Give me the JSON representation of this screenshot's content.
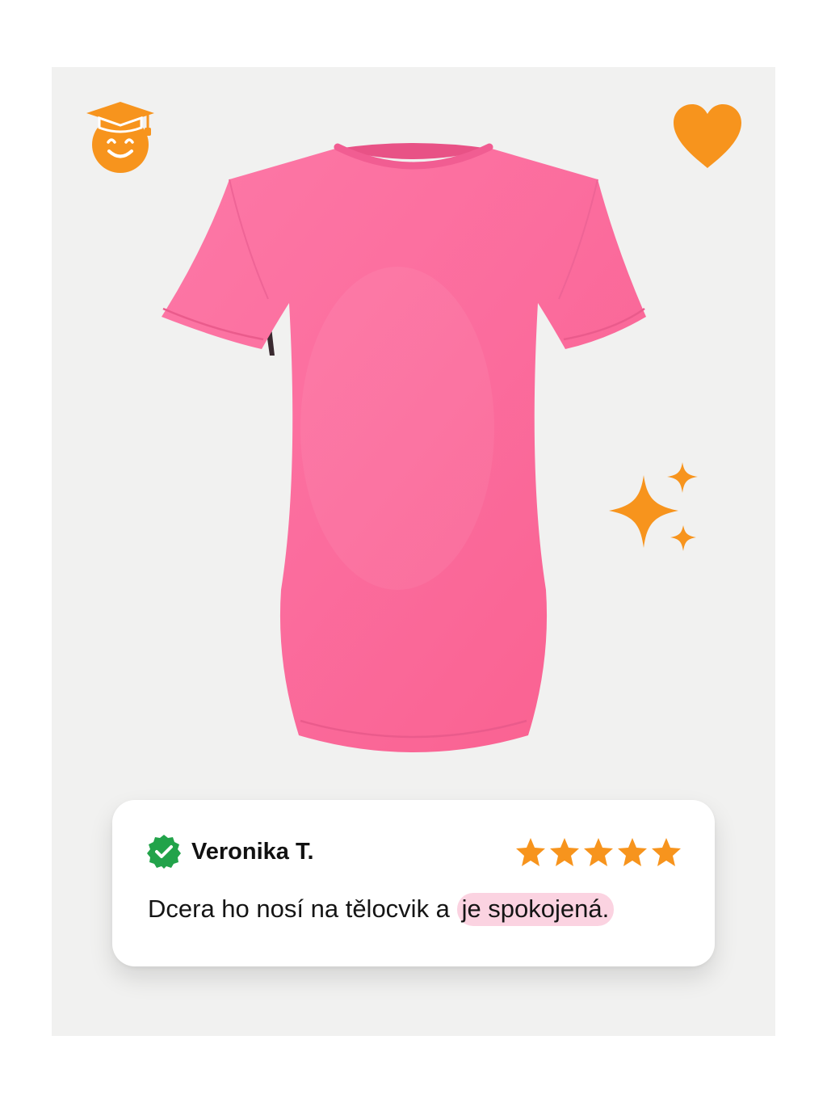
{
  "colors": {
    "accent": "#f7941d",
    "panel_background": "#f1f1f0",
    "shirt": "#fb6c9d",
    "verified": "#22a34a",
    "highlight": "#fbd3e1"
  },
  "icons": {
    "top_left": "graduation-cap-smiley-icon",
    "top_right": "heart-icon",
    "right": "sparkles-icon",
    "verified": "verified-check-badge-icon",
    "rating": "star-icon"
  },
  "review": {
    "name": "Veronika T.",
    "rating": 5,
    "rating_max": 5,
    "text_plain": "Dcera ho nosí na tělocvik a",
    "text_highlight": "je spokojená."
  }
}
